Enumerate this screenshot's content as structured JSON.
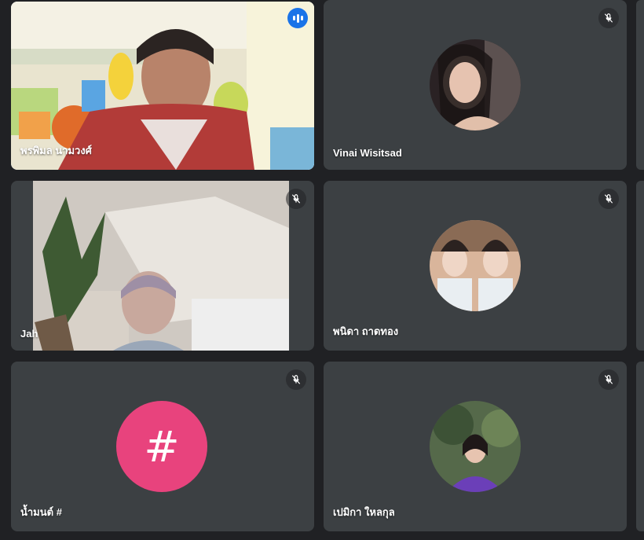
{
  "participants": [
    {
      "name": "พรพิมล นามวงศ์",
      "speaking": true
    },
    {
      "name": "Vinai Wisitsad",
      "muted": true
    },
    {
      "name": "Jah",
      "muted": true
    },
    {
      "name": "พนิดา ถาดทอง",
      "muted": true
    },
    {
      "name": "น้ำมนต์ #",
      "muted": true,
      "avatar_letter": "#",
      "avatar_color": "#e8437d"
    },
    {
      "name": "เปมิกา ใหลกุล",
      "muted": true
    }
  ],
  "colors": {
    "tile_bg": "#3c4043",
    "page_bg": "#202124",
    "active_border": "#8ab4f8",
    "speaking_badge": "#1a73e8"
  },
  "icons": {
    "muted": "mic-off-icon",
    "speaking": "audio-level-icon"
  }
}
